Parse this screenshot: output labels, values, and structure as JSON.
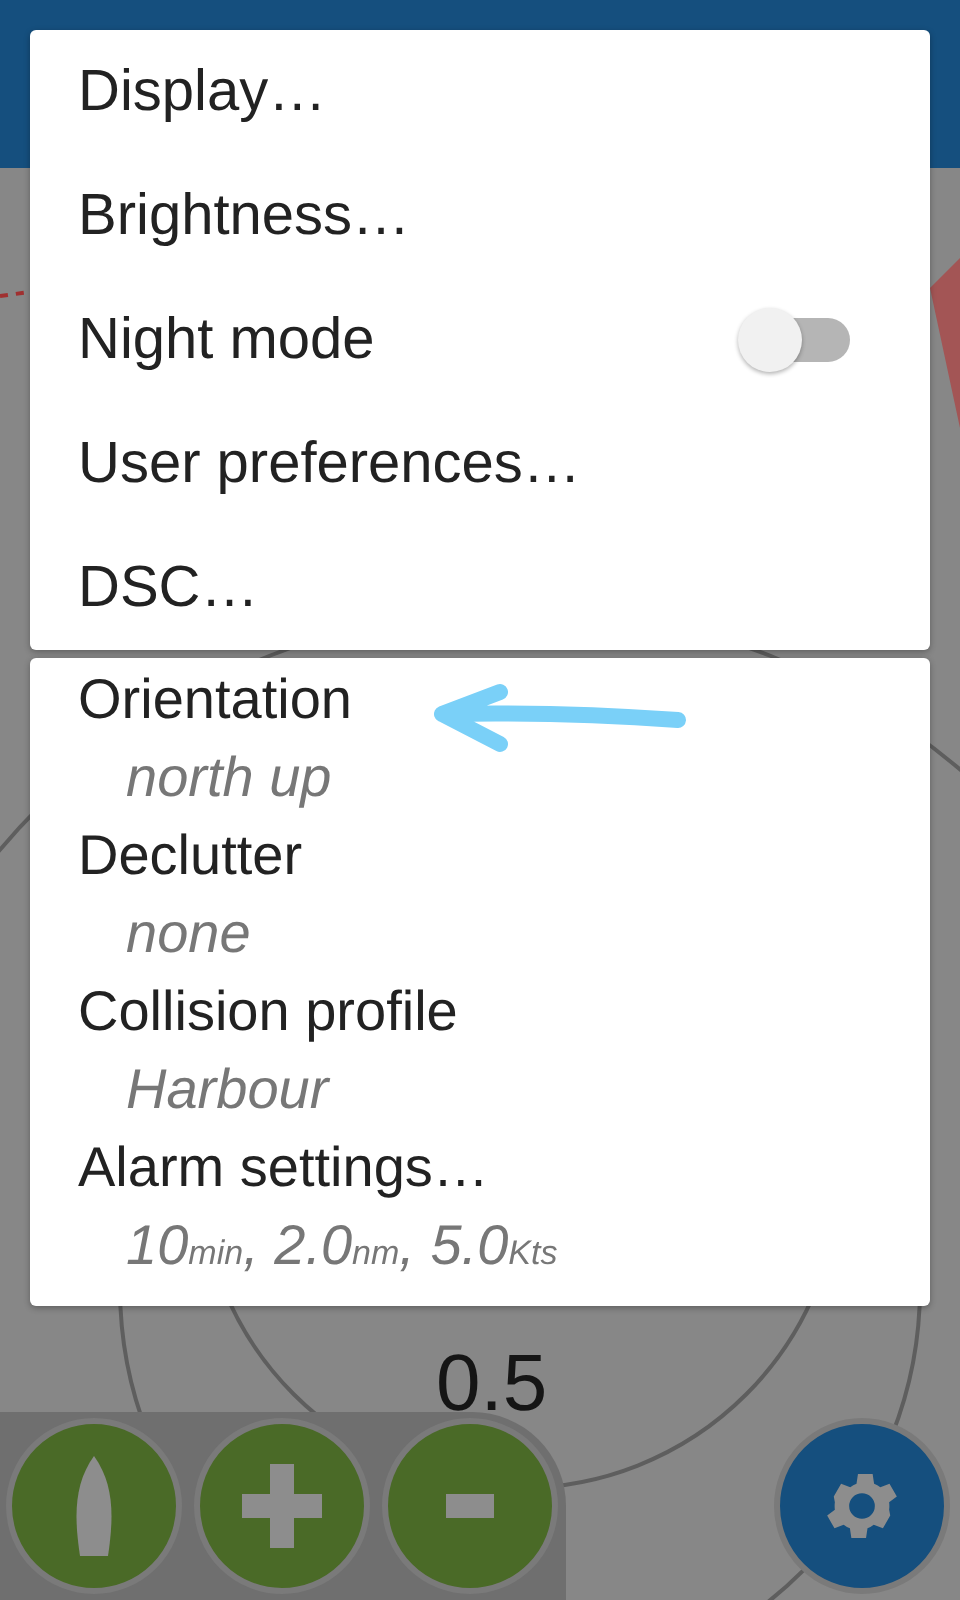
{
  "menu": [
    {
      "kind": "link",
      "label": "Display…"
    },
    {
      "kind": "link",
      "label": "Brightness…"
    },
    {
      "kind": "toggle",
      "label": "Night mode",
      "on": false
    },
    {
      "kind": "link",
      "label": "User preferences…"
    },
    {
      "kind": "link",
      "label": "DSC…"
    }
  ],
  "settings": [
    {
      "label": "Orientation",
      "value": "north up"
    },
    {
      "label": "Declutter",
      "value": "none"
    },
    {
      "label": "Collision profile",
      "value": "Harbour"
    },
    {
      "label": "Alarm settings…",
      "value": "10$_{min}$, 2.0$_{nm}$, 5.0$_{Kts}$"
    }
  ],
  "range_labels": [
    "0.5"
  ]
}
